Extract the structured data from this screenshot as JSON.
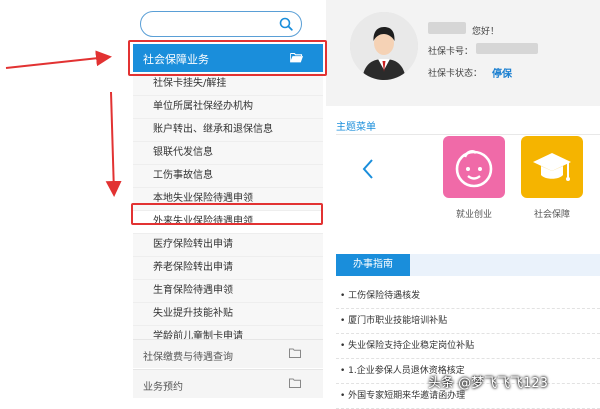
{
  "sidebar": {
    "search": {
      "value": "",
      "placeholder": ""
    },
    "active": {
      "label": "社会保障业务"
    },
    "submenu": [
      "社保卡挂失/解挂",
      "单位所属社保经办机构",
      "账户转出、继承和退保信息",
      "银联代发信息",
      "工伤事故信息",
      "本地失业保险待遇申领",
      "外来失业保险待遇申领",
      "医疗保险转出申请",
      "养老保险转出申请",
      "生育保险待遇申领",
      "失业提升技能补贴",
      "学龄前儿童制卡申请"
    ],
    "categories": [
      "社保缴费与待遇查询",
      "业务预约"
    ]
  },
  "profile": {
    "greeting": "您好！",
    "card_no_label": "社保卡号：",
    "card_status_label": "社保卡状态：",
    "card_status_value": "停保"
  },
  "menu": {
    "title": "主题菜单",
    "tiles": [
      "就业创业",
      "社会保障"
    ]
  },
  "guide": {
    "tab": "办事指南",
    "items": [
      "工伤保险待遇核发",
      "厦门市职业技能培训补贴",
      "失业保险支持企业稳定岗位补贴",
      "1.企业参保人员退休资格核定",
      "外国专家短期来华邀请函办理"
    ]
  },
  "watermark": "头条 @梦飞飞飞123",
  "colors": {
    "accent": "#1a8edb",
    "annotation": "#e23232",
    "tile_pink": "#f06aa8",
    "tile_yellow": "#f5b400",
    "status": "#1a7fd0"
  }
}
